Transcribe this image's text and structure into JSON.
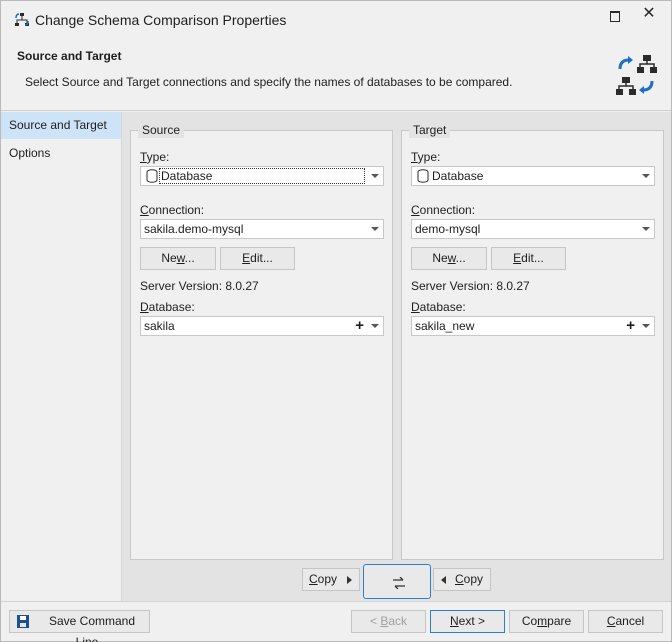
{
  "window": {
    "title": "Change Schema Comparison Properties"
  },
  "header": {
    "title": "Source and Target",
    "description": "Select Source and Target connections and specify the names of databases to be compared."
  },
  "nav": {
    "items": [
      {
        "label": "Source and Target"
      },
      {
        "label": "Options"
      }
    ]
  },
  "source": {
    "legend": "Source",
    "type_label": "Type:",
    "type_value": "Database",
    "connection_label": "Connection:",
    "connection_value": "sakila.demo-mysql",
    "new_label": "New...",
    "edit_label": "Edit...",
    "server_version": "Server Version: 8.0.27",
    "database_label": "Database:",
    "database_value": "sakila"
  },
  "target": {
    "legend": "Target",
    "type_label": "Type:",
    "type_value": "Database",
    "connection_label": "Connection:",
    "connection_value": "demo-mysql",
    "new_label": "New...",
    "edit_label": "Edit...",
    "server_version": "Server Version: 8.0.27",
    "database_label": "Database:",
    "database_value": "sakila_new"
  },
  "actions": {
    "copy_right_label": "Copy",
    "swap_icon": "swap-arrows-icon",
    "copy_left_label": "Copy"
  },
  "footer": {
    "save_label": "Save Command Line...",
    "back_label": "< Back",
    "next_label": "Next >",
    "compare_label": "Compare",
    "cancel_label": "Cancel"
  },
  "colors": {
    "accent": "#2a7fd0",
    "nav_active": "#cde3f7",
    "icon_blue": "#1e6fc6",
    "icon_dark": "#2b2b2b"
  }
}
